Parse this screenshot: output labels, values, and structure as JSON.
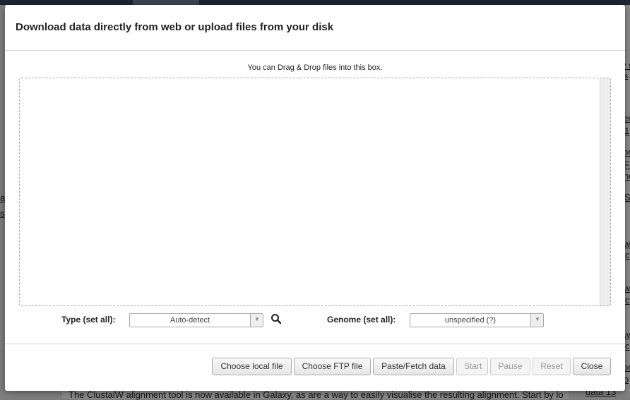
{
  "background": {
    "right_fragments": [
      "v s",
      "s",
      "er",
      "1",
      "on",
      "Fi",
      "ne",
      "S",
      "w",
      "c",
      "w",
      "c",
      "w",
      "c",
      "on",
      "o"
    ],
    "left_fragments": [
      "a",
      "s"
    ],
    "bottom_text": "The ClustalW alignment tool is now available in Galaxy, as are a way to easily visualise the resulting alignment. Start by loading",
    "bottom_link": "data 13"
  },
  "modal": {
    "title": "Download data directly from web or upload files from your disk",
    "hint": "You can Drag & Drop files into this box."
  },
  "settings": {
    "type_label": "Type (set all):",
    "type_value": "Auto-detect",
    "genome_label": "Genome (set all):",
    "genome_value": "unspecified (?)"
  },
  "footer": {
    "choose_local": "Choose local file",
    "choose_ftp": "Choose FTP file",
    "paste_fetch": "Paste/Fetch data",
    "start": "Start",
    "pause": "Pause",
    "reset": "Reset",
    "close": "Close"
  },
  "icons": {
    "search": "search-icon",
    "dropdown": "chevron-down-icon"
  }
}
